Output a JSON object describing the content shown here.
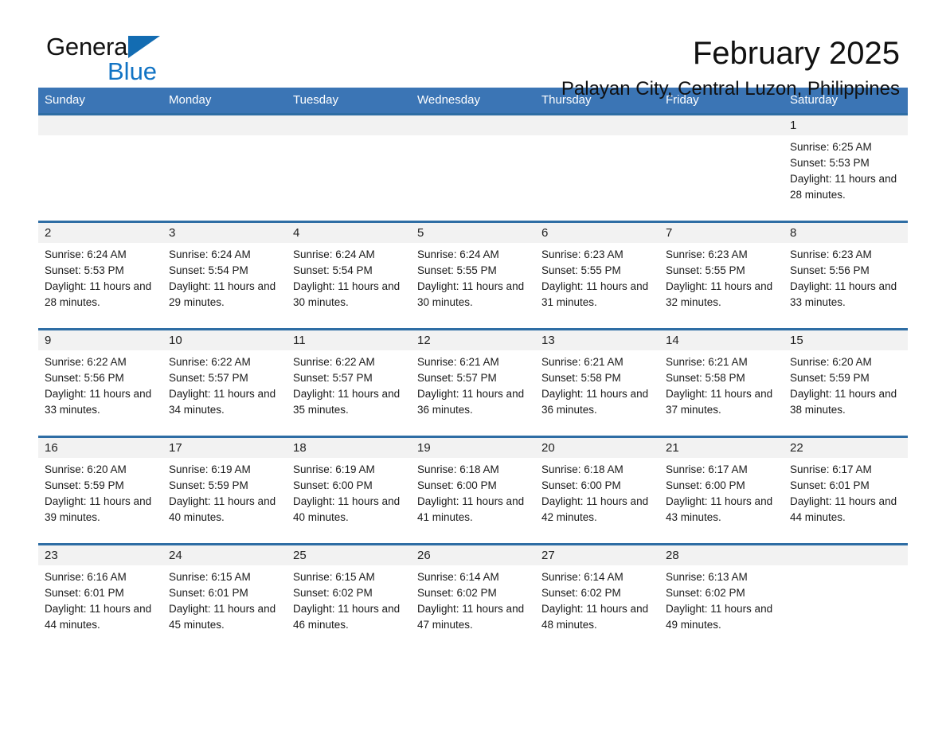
{
  "brand": {
    "name_line1": "General",
    "name_line2": "Blue",
    "accent_color": "#1173c4"
  },
  "header": {
    "title": "February 2025",
    "subtitle": "Palayan City, Central Luzon, Philippines",
    "header_bg_color": "#3b75b5",
    "row_band_color": "#f2f2f2"
  },
  "calendar": {
    "weekday_headers": [
      "Sunday",
      "Monday",
      "Tuesday",
      "Wednesday",
      "Thursday",
      "Friday",
      "Saturday"
    ],
    "labels": {
      "sunrise_prefix": "Sunrise:",
      "sunset_prefix": "Sunset:",
      "daylight_prefix": "Daylight:"
    },
    "weeks": [
      [
        {
          "day": "",
          "sunrise": "",
          "sunset": "",
          "daylight": ""
        },
        {
          "day": "",
          "sunrise": "",
          "sunset": "",
          "daylight": ""
        },
        {
          "day": "",
          "sunrise": "",
          "sunset": "",
          "daylight": ""
        },
        {
          "day": "",
          "sunrise": "",
          "sunset": "",
          "daylight": ""
        },
        {
          "day": "",
          "sunrise": "",
          "sunset": "",
          "daylight": ""
        },
        {
          "day": "",
          "sunrise": "",
          "sunset": "",
          "daylight": ""
        },
        {
          "day": "1",
          "sunrise": "Sunrise: 6:25 AM",
          "sunset": "Sunset: 5:53 PM",
          "daylight": "Daylight: 11 hours and 28 minutes."
        }
      ],
      [
        {
          "day": "2",
          "sunrise": "Sunrise: 6:24 AM",
          "sunset": "Sunset: 5:53 PM",
          "daylight": "Daylight: 11 hours and 28 minutes."
        },
        {
          "day": "3",
          "sunrise": "Sunrise: 6:24 AM",
          "sunset": "Sunset: 5:54 PM",
          "daylight": "Daylight: 11 hours and 29 minutes."
        },
        {
          "day": "4",
          "sunrise": "Sunrise: 6:24 AM",
          "sunset": "Sunset: 5:54 PM",
          "daylight": "Daylight: 11 hours and 30 minutes."
        },
        {
          "day": "5",
          "sunrise": "Sunrise: 6:24 AM",
          "sunset": "Sunset: 5:55 PM",
          "daylight": "Daylight: 11 hours and 30 minutes."
        },
        {
          "day": "6",
          "sunrise": "Sunrise: 6:23 AM",
          "sunset": "Sunset: 5:55 PM",
          "daylight": "Daylight: 11 hours and 31 minutes."
        },
        {
          "day": "7",
          "sunrise": "Sunrise: 6:23 AM",
          "sunset": "Sunset: 5:55 PM",
          "daylight": "Daylight: 11 hours and 32 minutes."
        },
        {
          "day": "8",
          "sunrise": "Sunrise: 6:23 AM",
          "sunset": "Sunset: 5:56 PM",
          "daylight": "Daylight: 11 hours and 33 minutes."
        }
      ],
      [
        {
          "day": "9",
          "sunrise": "Sunrise: 6:22 AM",
          "sunset": "Sunset: 5:56 PM",
          "daylight": "Daylight: 11 hours and 33 minutes."
        },
        {
          "day": "10",
          "sunrise": "Sunrise: 6:22 AM",
          "sunset": "Sunset: 5:57 PM",
          "daylight": "Daylight: 11 hours and 34 minutes."
        },
        {
          "day": "11",
          "sunrise": "Sunrise: 6:22 AM",
          "sunset": "Sunset: 5:57 PM",
          "daylight": "Daylight: 11 hours and 35 minutes."
        },
        {
          "day": "12",
          "sunrise": "Sunrise: 6:21 AM",
          "sunset": "Sunset: 5:57 PM",
          "daylight": "Daylight: 11 hours and 36 minutes."
        },
        {
          "day": "13",
          "sunrise": "Sunrise: 6:21 AM",
          "sunset": "Sunset: 5:58 PM",
          "daylight": "Daylight: 11 hours and 36 minutes."
        },
        {
          "day": "14",
          "sunrise": "Sunrise: 6:21 AM",
          "sunset": "Sunset: 5:58 PM",
          "daylight": "Daylight: 11 hours and 37 minutes."
        },
        {
          "day": "15",
          "sunrise": "Sunrise: 6:20 AM",
          "sunset": "Sunset: 5:59 PM",
          "daylight": "Daylight: 11 hours and 38 minutes."
        }
      ],
      [
        {
          "day": "16",
          "sunrise": "Sunrise: 6:20 AM",
          "sunset": "Sunset: 5:59 PM",
          "daylight": "Daylight: 11 hours and 39 minutes."
        },
        {
          "day": "17",
          "sunrise": "Sunrise: 6:19 AM",
          "sunset": "Sunset: 5:59 PM",
          "daylight": "Daylight: 11 hours and 40 minutes."
        },
        {
          "day": "18",
          "sunrise": "Sunrise: 6:19 AM",
          "sunset": "Sunset: 6:00 PM",
          "daylight": "Daylight: 11 hours and 40 minutes."
        },
        {
          "day": "19",
          "sunrise": "Sunrise: 6:18 AM",
          "sunset": "Sunset: 6:00 PM",
          "daylight": "Daylight: 11 hours and 41 minutes."
        },
        {
          "day": "20",
          "sunrise": "Sunrise: 6:18 AM",
          "sunset": "Sunset: 6:00 PM",
          "daylight": "Daylight: 11 hours and 42 minutes."
        },
        {
          "day": "21",
          "sunrise": "Sunrise: 6:17 AM",
          "sunset": "Sunset: 6:00 PM",
          "daylight": "Daylight: 11 hours and 43 minutes."
        },
        {
          "day": "22",
          "sunrise": "Sunrise: 6:17 AM",
          "sunset": "Sunset: 6:01 PM",
          "daylight": "Daylight: 11 hours and 44 minutes."
        }
      ],
      [
        {
          "day": "23",
          "sunrise": "Sunrise: 6:16 AM",
          "sunset": "Sunset: 6:01 PM",
          "daylight": "Daylight: 11 hours and 44 minutes."
        },
        {
          "day": "24",
          "sunrise": "Sunrise: 6:15 AM",
          "sunset": "Sunset: 6:01 PM",
          "daylight": "Daylight: 11 hours and 45 minutes."
        },
        {
          "day": "25",
          "sunrise": "Sunrise: 6:15 AM",
          "sunset": "Sunset: 6:02 PM",
          "daylight": "Daylight: 11 hours and 46 minutes."
        },
        {
          "day": "26",
          "sunrise": "Sunrise: 6:14 AM",
          "sunset": "Sunset: 6:02 PM",
          "daylight": "Daylight: 11 hours and 47 minutes."
        },
        {
          "day": "27",
          "sunrise": "Sunrise: 6:14 AM",
          "sunset": "Sunset: 6:02 PM",
          "daylight": "Daylight: 11 hours and 48 minutes."
        },
        {
          "day": "28",
          "sunrise": "Sunrise: 6:13 AM",
          "sunset": "Sunset: 6:02 PM",
          "daylight": "Daylight: 11 hours and 49 minutes."
        },
        {
          "day": "",
          "sunrise": "",
          "sunset": "",
          "daylight": ""
        }
      ]
    ]
  }
}
